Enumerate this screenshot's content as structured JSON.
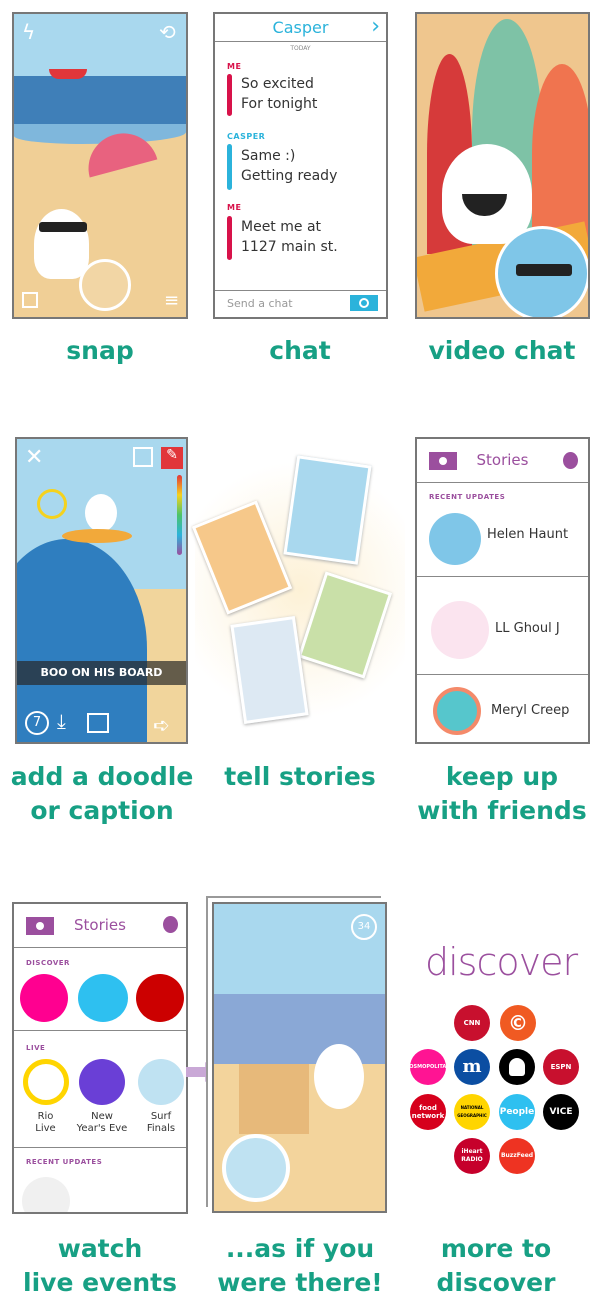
{
  "captions": {
    "snap": "snap",
    "chat": "chat",
    "video_chat": "video chat",
    "doodle_1": "add a doodle",
    "doodle_2": "or caption",
    "stories_1": "tell stories",
    "friends_1": "keep up",
    "friends_2": "with friends",
    "live_1": "watch",
    "live_2": "live events",
    "there_1": "...as if you",
    "there_2": "were there!",
    "more_1": "more to",
    "more_2": "discover"
  },
  "chat": {
    "title": "Casper",
    "date": "TODAY",
    "messages": [
      {
        "sender": "ME",
        "lines": [
          "So excited",
          "For tonight"
        ],
        "color": "#d8124a"
      },
      {
        "sender": "CASPER",
        "lines": [
          "Same :)",
          "Getting ready"
        ],
        "color": "#2bb3db"
      },
      {
        "sender": "ME",
        "lines": [
          "Meet me at",
          "1127 main st."
        ],
        "color": "#d8124a"
      }
    ],
    "placeholder": "Send a chat"
  },
  "doodle": {
    "caption_text": "BOO ON HIS BOARD",
    "timer": "7"
  },
  "stories_friends": {
    "title": "Stories",
    "section": "RECENT UPDATES",
    "friends": [
      "Helen Haunt",
      "LL Ghoul J",
      "Meryl Creep"
    ]
  },
  "stories_live": {
    "title": "Stories",
    "discover_label": "DISCOVER",
    "discover_colors": [
      "#ff0090",
      "#2ec0f0",
      "#cc0000"
    ],
    "live_label": "LIVE",
    "live": [
      [
        "Rio",
        "Live"
      ],
      [
        "New",
        "Year's Eve"
      ],
      [
        "Surf",
        "Finals"
      ]
    ],
    "recent_label": "RECENT UPDATES"
  },
  "live_event": {
    "count": "34"
  },
  "discover": {
    "title": "discover",
    "channels": [
      "CNN",
      "Comedy Central",
      "COSMOPOLITAN",
      "Daily Mail",
      "Snapchat",
      "ESPN",
      "food network",
      "NATIONAL GEOGRAPHIC",
      "People",
      "VICE",
      "iHeart RADIO",
      "BuzzFeed"
    ]
  },
  "colors": {
    "accent": "#17a084",
    "purple": "#9b4f9e",
    "chat_blue": "#2bb3db",
    "me_red": "#d8124a"
  }
}
